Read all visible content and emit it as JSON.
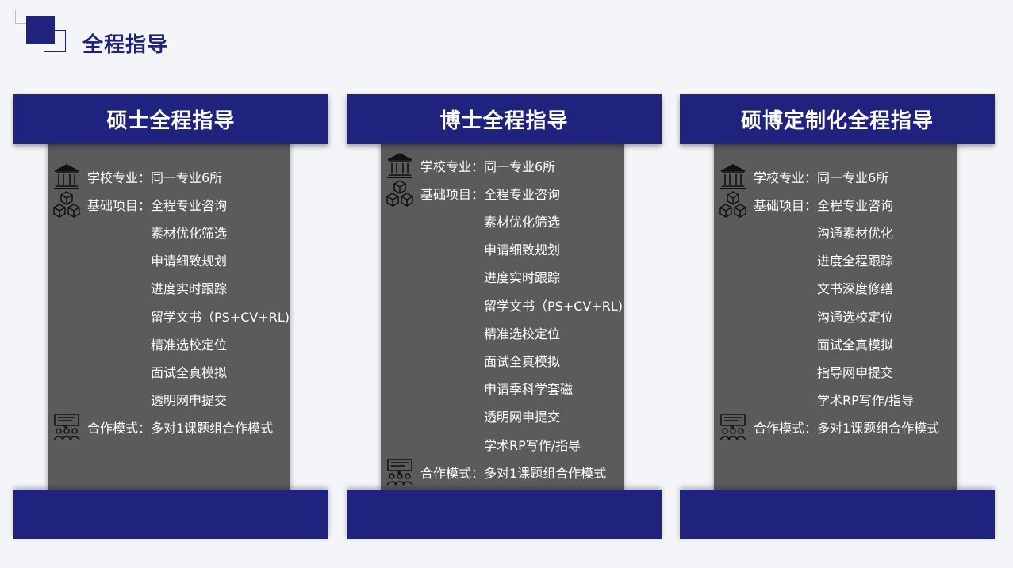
{
  "page": {
    "title": "全程指导"
  },
  "columns": [
    {
      "title": "硕士全程指导",
      "school_label": "学校专业：",
      "school_value": "同一专业6所",
      "basic_label": "基础项目：",
      "basic_items": [
        "全程专业咨询",
        "素材优化筛选",
        "申请细致规划",
        "进度实时跟踪",
        "留学文书（PS+CV+RL)",
        "精准选校定位",
        "面试全真模拟",
        "透明网申提交"
      ],
      "coop_label": "合作模式：",
      "coop_value": "多对1课题组合作模式"
    },
    {
      "title": "博士全程指导",
      "school_label": "学校专业：",
      "school_value": "同一专业6所",
      "basic_label": "基础项目：",
      "basic_items": [
        "全程专业咨询",
        "素材优化筛选",
        "申请细致规划",
        "进度实时跟踪",
        "留学文书（PS+CV+RL)",
        "精准选校定位",
        "面试全真模拟",
        "申请季科学套磁",
        "透明网申提交",
        "学术RP写作/指导"
      ],
      "coop_label": "合作模式：",
      "coop_value": "多对1课题组合作模式"
    },
    {
      "title": "硕博定制化全程指导",
      "school_label": "学校专业：",
      "school_value": "同一专业6所",
      "basic_label": "基础项目：",
      "basic_items": [
        "全程专业咨询",
        "沟通素材优化",
        "进度全程跟踪",
        "文书深度修缮",
        "沟通选校定位",
        "面试全真模拟",
        "指导网申提交",
        "学术RP写作/指导"
      ],
      "coop_label": "合作模式：",
      "coop_value": "多对1课题组合作模式"
    }
  ],
  "icons": {
    "school": "university-building-icon",
    "basic": "stacked-cubes-icon",
    "coop": "team-presentation-icon"
  },
  "colors": {
    "brand": "#1f237d",
    "panel": "#5b5b5b",
    "background": "#f4f5f8",
    "text_on_dark": "#ffffff"
  }
}
